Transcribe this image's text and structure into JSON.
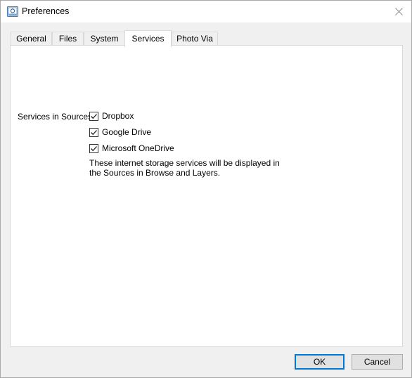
{
  "window": {
    "title": "Preferences",
    "icon": "preferences-app-icon",
    "close_icon": "close-icon"
  },
  "tabs": [
    {
      "label": "General",
      "active": false
    },
    {
      "label": "Files",
      "active": false
    },
    {
      "label": "System",
      "active": false
    },
    {
      "label": "Services",
      "active": true
    },
    {
      "label": "Photo Via",
      "active": false
    }
  ],
  "services": {
    "label": "Services in Sources:",
    "options": [
      {
        "label": "Dropbox",
        "checked": true
      },
      {
        "label": "Google Drive",
        "checked": true
      },
      {
        "label": "Microsoft OneDrive",
        "checked": true
      }
    ],
    "info": "These internet storage services will be displayed in the Sources in Browse and Layers."
  },
  "buttons": {
    "ok": "OK",
    "cancel": "Cancel"
  },
  "colors": {
    "accent": "#0078d7",
    "window_bg": "#f0f0f0",
    "panel_bg": "#ffffff"
  }
}
